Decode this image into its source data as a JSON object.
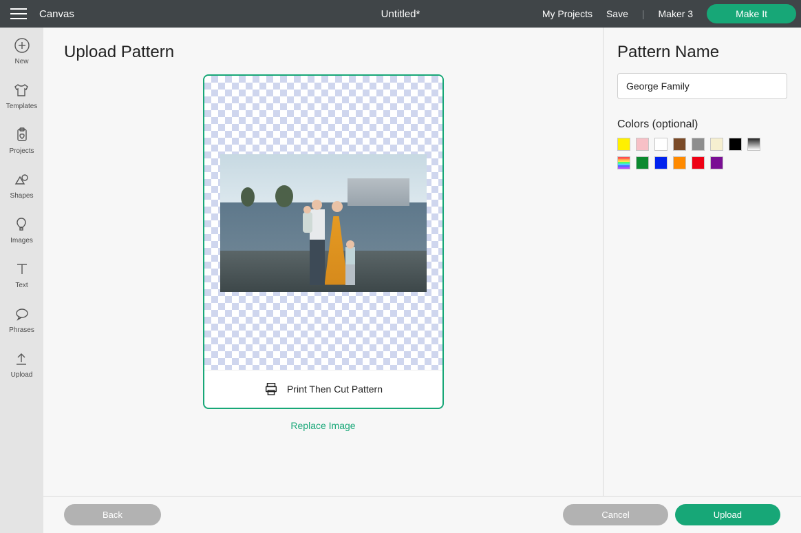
{
  "topbar": {
    "app_title": "Canvas",
    "project_title": "Untitled*",
    "links": {
      "my_projects": "My Projects",
      "save": "Save",
      "machine": "Maker 3"
    },
    "make_it": "Make It"
  },
  "sidebar": {
    "items": [
      {
        "label": "New",
        "icon": "plus-circle-icon"
      },
      {
        "label": "Templates",
        "icon": "shirt-icon"
      },
      {
        "label": "Projects",
        "icon": "clipboard-icon"
      },
      {
        "label": "Shapes",
        "icon": "shapes-icon"
      },
      {
        "label": "Images",
        "icon": "hot-air-balloon-icon"
      },
      {
        "label": "Text",
        "icon": "text-icon"
      },
      {
        "label": "Phrases",
        "icon": "speech-bubble-icon"
      },
      {
        "label": "Upload",
        "icon": "upload-icon"
      }
    ]
  },
  "main": {
    "title": "Upload Pattern",
    "card_footer_label": "Print Then Cut Pattern",
    "replace_link": "Replace Image"
  },
  "right": {
    "title": "Pattern Name",
    "name_value": "George Family",
    "colors_title": "Colors (optional)",
    "swatches": [
      "#fff000",
      "#f7c0c6",
      "#ffffff",
      "#7a4a27",
      "#8d8d8d",
      "#f6efd0",
      "#000000",
      "gradient",
      "rainbow",
      "#0b8a2f",
      "#0022ee",
      "#ff8a00",
      "#ee0014",
      "#7a0f94"
    ]
  },
  "footer": {
    "back": "Back",
    "cancel": "Cancel",
    "upload": "Upload"
  }
}
